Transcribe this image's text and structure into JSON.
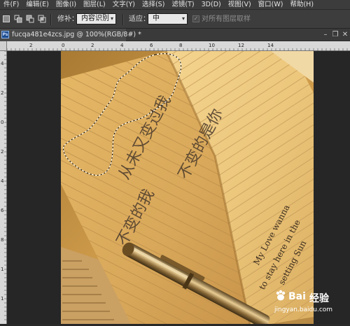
{
  "menubar": {
    "items": [
      "件(F)",
      "编辑(E)",
      "图像(I)",
      "图层(L)",
      "文字(Y)",
      "选择(S)",
      "滤镜(T)",
      "3D(D)",
      "视图(V)",
      "窗口(W)",
      "帮助(H)"
    ]
  },
  "options": {
    "feather_label": "修补：",
    "feather_value": "内容识别",
    "adapt_label": "适应：",
    "adapt_value": "中",
    "sample_all_layers": "对所有图层取样"
  },
  "document": {
    "tab_title": "fucqa481e4zcs.jpg @ 100%(RGB/8#) *",
    "ps_badge": "Ps"
  },
  "ruler_h": {
    "labels": [
      "2",
      "0",
      "2",
      "4",
      "6",
      "8",
      "10",
      "12",
      "14"
    ]
  },
  "ruler_v": {
    "labels": [
      "4",
      "2",
      "0",
      "2",
      "4",
      "6",
      "8",
      "1",
      "1",
      "1"
    ]
  },
  "photo": {
    "handwriting_left": "从未又变过我",
    "handwriting_mid": "不变的是你",
    "handwriting_bottom": "不变的我",
    "english_line1": "My Love wanna",
    "english_line2": "to stay here in the",
    "english_line3": "setting Sun"
  },
  "watermark": {
    "brand": "Bai",
    "brand2": "经验",
    "url": "jingyan.baidu.com"
  },
  "colors": {
    "menubar_bg": "#3c3c3c",
    "options_bg": "#3d3d3d",
    "canvas_bg": "#262626",
    "ruler_bg": "#d8d8d8",
    "paper": "#e3b56a"
  }
}
